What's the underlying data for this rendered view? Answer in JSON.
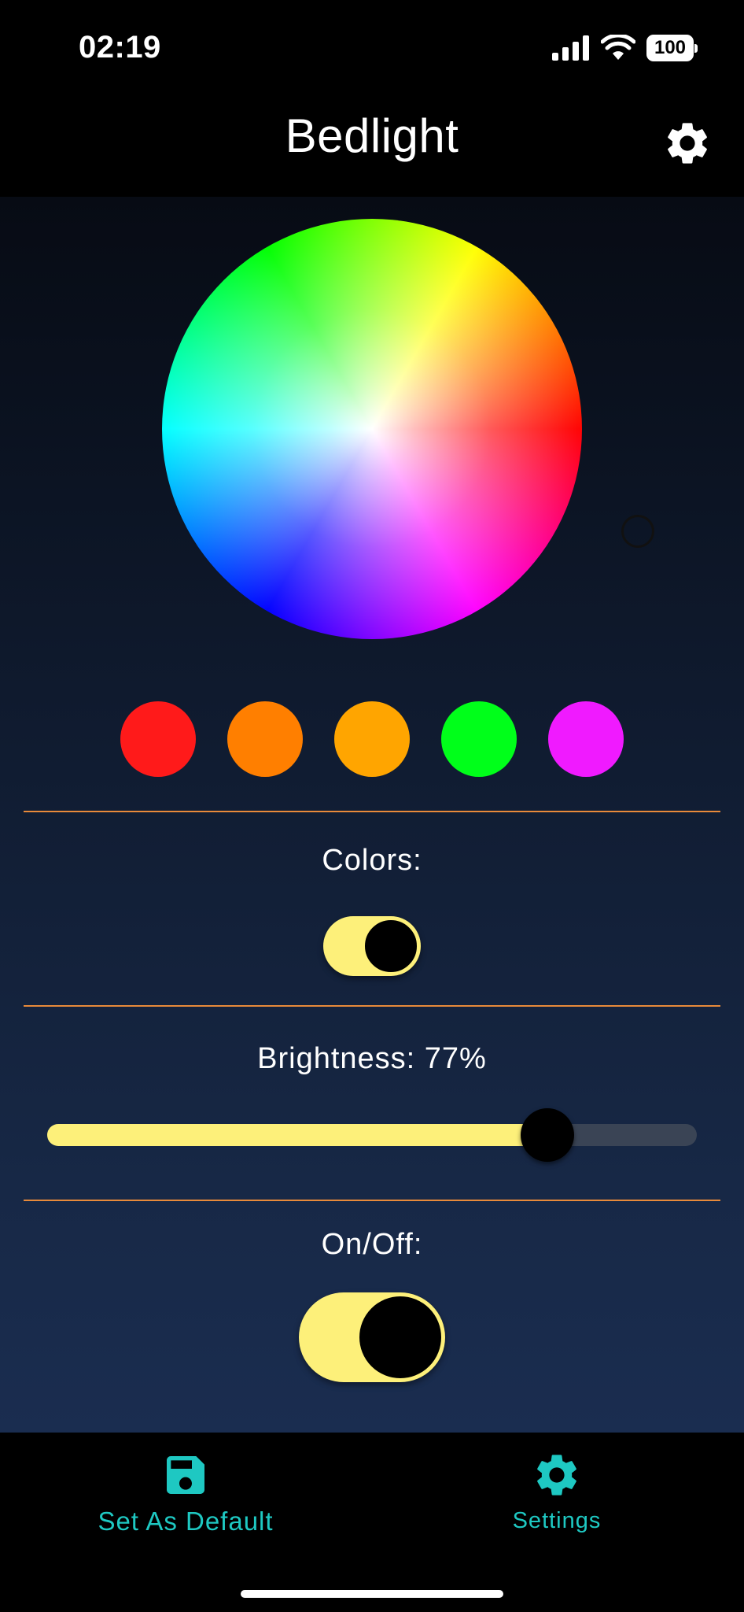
{
  "status_bar": {
    "time": "02:19",
    "battery": "100",
    "icons": [
      "cellular-signal-icon",
      "wifi-icon",
      "battery-icon"
    ]
  },
  "header": {
    "title": "Bedlight",
    "icon": "gear-icon"
  },
  "color_wheel": {
    "icon": "color-wheel"
  },
  "presets": [
    {
      "color": "#ff1a1a"
    },
    {
      "color": "#ff7f00"
    },
    {
      "color": "#ffa500"
    },
    {
      "color": "#00ff1a"
    },
    {
      "color": "#f01aff"
    }
  ],
  "colors_section": {
    "label": "Colors:",
    "toggle_on": true
  },
  "brightness_section": {
    "label": "Brightness: 77%",
    "value_percent": 77
  },
  "power_section": {
    "label": "On/Off:",
    "toggle_on": true
  },
  "bottom_nav": {
    "set_default": {
      "label": "Set As Default",
      "icon": "floppy-disk-icon"
    },
    "settings": {
      "label": "Settings",
      "icon": "gear-icon"
    }
  },
  "colors": {
    "accent": "#1ec8c2",
    "toggle_track": "#fdf07a",
    "divider": "#e88a3a"
  }
}
